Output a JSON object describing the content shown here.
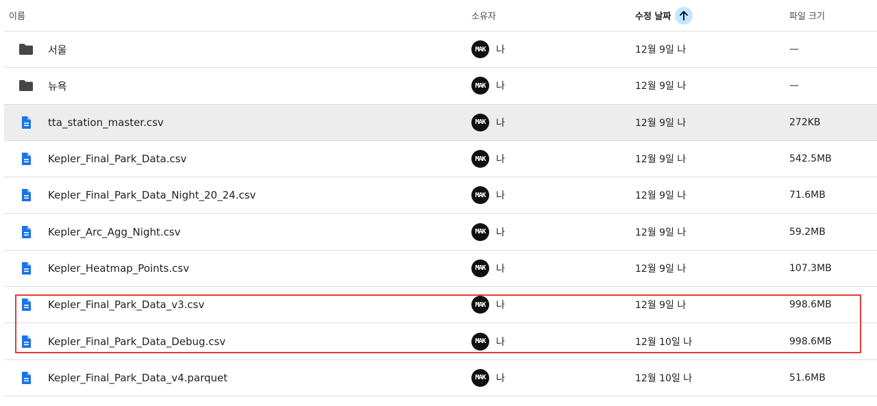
{
  "header": {
    "name": "이름",
    "owner": "소유자",
    "modified": "수정 날짜",
    "size": "파일 크기",
    "sort_icon": "arrow-up-icon"
  },
  "avatar_text": "MAK",
  "rows": [
    {
      "name": "서울",
      "type": "folder",
      "owner": "나",
      "modified": "12월 9일 나",
      "size": "—"
    },
    {
      "name": "뉴욕",
      "type": "folder",
      "owner": "나",
      "modified": "12월 9일 나",
      "size": "—"
    },
    {
      "name": "tta_station_master.csv",
      "type": "file",
      "owner": "나",
      "modified": "12월 9일 나",
      "size": "272KB",
      "selected": true
    },
    {
      "name": "Kepler_Final_Park_Data.csv",
      "type": "file",
      "owner": "나",
      "modified": "12월 9일 나",
      "size": "542.5MB"
    },
    {
      "name": "Kepler_Final_Park_Data_Night_20_24.csv",
      "type": "file",
      "owner": "나",
      "modified": "12월 9일 나",
      "size": "71.6MB"
    },
    {
      "name": "Kepler_Arc_Agg_Night.csv",
      "type": "file",
      "owner": "나",
      "modified": "12월 9일 나",
      "size": "59.2MB"
    },
    {
      "name": "Kepler_Heatmap_Points.csv",
      "type": "file",
      "owner": "나",
      "modified": "12월 9일 나",
      "size": "107.3MB"
    },
    {
      "name": "Kepler_Final_Park_Data_v3.csv",
      "type": "file",
      "owner": "나",
      "modified": "12월 9일 나",
      "size": "998.6MB"
    },
    {
      "name": "Kepler_Final_Park_Data_Debug.csv",
      "type": "file",
      "owner": "나",
      "modified": "12월 10일 나",
      "size": "998.6MB"
    },
    {
      "name": "Kepler_Final_Park_Data_v4.parquet",
      "type": "file",
      "owner": "나",
      "modified": "12월 10일 나",
      "size": "51.6MB"
    }
  ],
  "colors": {
    "folder": "#444746",
    "file": "#1a73e8",
    "highlight_border": "#e53935",
    "sort_button": "#c2e7ff"
  }
}
